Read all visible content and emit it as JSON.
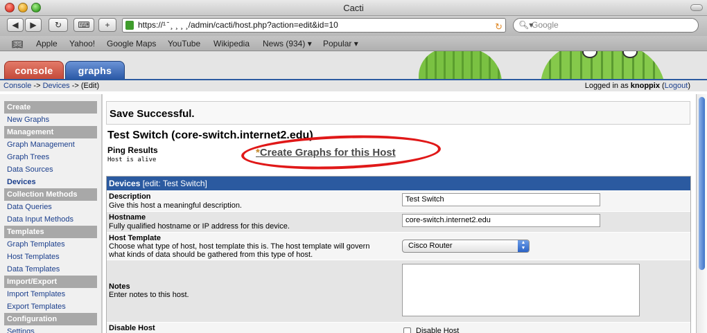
{
  "window": {
    "title": "Cacti"
  },
  "toolbar": {
    "back": "◀",
    "forward": "▶",
    "reload": "↻",
    "snapshot": "⌨",
    "add": "+",
    "url": "https://¹  ̄      ¸ ¸ ¸ ¸/admin/cacti/host.php?action=edit&id=10",
    "search_placeholder": "Google"
  },
  "bookmarks": [
    "Apple",
    "Yahoo!",
    "Google Maps",
    "YouTube",
    "Wikipedia",
    "News (934) ▾",
    "Popular ▾"
  ],
  "tabs": {
    "console": "console",
    "graphs": "graphs"
  },
  "breadcrumb": {
    "console": "Console",
    "sep1": " -> ",
    "devices": "Devices",
    "sep2": " -> (Edit)"
  },
  "login": {
    "prefix": "Logged in as ",
    "user": "knoppix",
    "open": " (",
    "logout": "Logout",
    "close": ")"
  },
  "sidebar": {
    "items": [
      {
        "label": "Create",
        "kind": "head"
      },
      {
        "label": "New Graphs",
        "kind": "link"
      },
      {
        "label": "Management",
        "kind": "head"
      },
      {
        "label": "Graph Management",
        "kind": "link"
      },
      {
        "label": "Graph Trees",
        "kind": "link"
      },
      {
        "label": "Data Sources",
        "kind": "link"
      },
      {
        "label": "Devices",
        "kind": "active"
      },
      {
        "label": "Collection Methods",
        "kind": "head"
      },
      {
        "label": "Data Queries",
        "kind": "link"
      },
      {
        "label": "Data Input Methods",
        "kind": "link"
      },
      {
        "label": "Templates",
        "kind": "head"
      },
      {
        "label": "Graph Templates",
        "kind": "link"
      },
      {
        "label": "Host Templates",
        "kind": "link"
      },
      {
        "label": "Data Templates",
        "kind": "link"
      },
      {
        "label": "Import/Export",
        "kind": "head"
      },
      {
        "label": "Import Templates",
        "kind": "link"
      },
      {
        "label": "Export Templates",
        "kind": "link"
      },
      {
        "label": "Configuration",
        "kind": "head"
      },
      {
        "label": "Settings",
        "kind": "link"
      }
    ]
  },
  "main": {
    "message": "Save Successful.",
    "host_title": "Test Switch (core-switch.internet2.edu)",
    "ping_heading": "Ping Results",
    "ping_result": "Host is alive",
    "create_star": "*",
    "create_link": "Create Graphs for this Host",
    "panel_title": "Devices",
    "panel_sub": " [edit: Test Switch]"
  },
  "form": {
    "description": {
      "label": "Description",
      "help": "Give this host a meaningful description.",
      "value": "Test Switch"
    },
    "hostname": {
      "label": "Hostname",
      "help": "Fully qualified hostname or IP address for this device.",
      "value": "core-switch.internet2.edu"
    },
    "host_template": {
      "label": "Host Template",
      "help1": "Choose what type of host, host template this is. The host template will govern",
      "help2": "what kinds of data should be gathered from this type of host.",
      "value": "Cisco Router"
    },
    "notes": {
      "label": "Notes",
      "help": "Enter notes to this host.",
      "value": ""
    },
    "disable": {
      "label": "Disable Host",
      "checkbox_label": "Disable Host"
    }
  },
  "colors": {
    "accent_blue": "#2b5aa0",
    "link": "#1a3e8c",
    "highlight_red": "#e01818"
  }
}
